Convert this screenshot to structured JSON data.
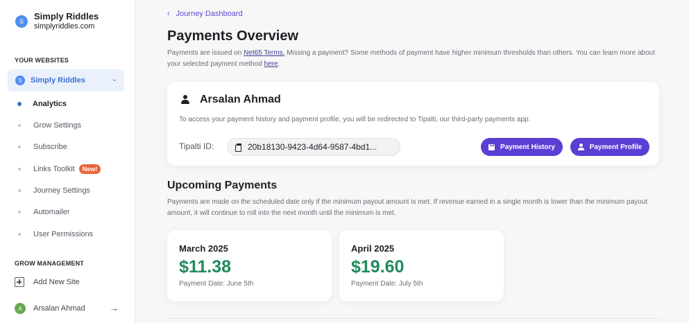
{
  "sidebar": {
    "site_avatar": "S",
    "site_name": "Simply Riddles",
    "site_domain": "simplyriddles.com",
    "your_websites_label": "YOUR WEBSITES",
    "selected_site": {
      "avatar": "S",
      "label": "Simply Riddles"
    },
    "nav": [
      {
        "label": "Analytics",
        "active": true
      },
      {
        "label": "Grow Settings"
      },
      {
        "label": "Subscribe"
      },
      {
        "label": "Links Toolkit",
        "badge": "New!"
      },
      {
        "label": "Journey Settings"
      },
      {
        "label": "Automailer"
      },
      {
        "label": "User Permissions"
      }
    ],
    "grow_management_label": "GROW MANAGEMENT",
    "add_site_label": "Add New Site",
    "user": {
      "avatar": "A",
      "name": "Arsalan Ahmad"
    },
    "logout_glyph": "→"
  },
  "main": {
    "back_label": "Journey Dashboard",
    "title": "Payments Overview",
    "intro": {
      "part1": "Payments are issued on ",
      "link1": "Net65 Terms.",
      "part2": " Missing a payment? Some methods of payment have higher minimum thresholds than others. You can learn more about your selected payment method ",
      "link2": "here",
      "part3": "."
    },
    "account": {
      "name": "Arsalan Ahmad",
      "note": "To access your payment history and payment profile, you will be redirected to Tipalti, our third-party payments app.",
      "tipalti_label": "Tipalti ID:",
      "tipalti_id": "20b18130-9423-4d64-9587-4bd1...",
      "history_button": "Payment History",
      "profile_button": "Payment Profile"
    },
    "upcoming": {
      "title": "Upcoming Payments",
      "description": "Payments are made on the scheduled date only if the minimum payout amount is met. If revenue earned in a single month is lower than the minimum payout amount, it will continue to roll into the next month until the minimum is met.",
      "cards": [
        {
          "month": "March 2025",
          "amount": "$11.38",
          "date": "Payment Date: June 5th"
        },
        {
          "month": "April 2025",
          "amount": "$19.60",
          "date": "Payment Date: July 5th"
        }
      ]
    }
  },
  "colors": {
    "accent": "#5b3fd4",
    "link": "#5b4bd6",
    "amount": "#218a5a",
    "badge": "#e8643c"
  }
}
